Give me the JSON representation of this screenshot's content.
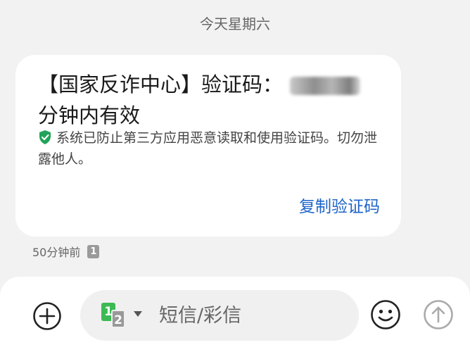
{
  "header": {
    "date_label": "今天星期六"
  },
  "message": {
    "text_before_code": "【国家反诈中心】验证码：",
    "text_after_code": "分钟内有效",
    "security_notice": "系统已防止第三方应用恶意读取和使用验证码。切勿泄露他人。",
    "copy_button_label": "复制验证码",
    "timestamp": "50分钟前",
    "sim_badge": "1"
  },
  "composer": {
    "placeholder": "短信/彩信",
    "sim_primary": "1",
    "sim_secondary": "2"
  },
  "icons": {
    "shield": "shield-check-icon",
    "add": "plus-circle-icon",
    "emoji": "smiley-icon",
    "send": "arrow-up-circle-icon"
  },
  "colors": {
    "accent": "#1e64c8",
    "shield_green": "#22a35a",
    "sim1_green": "#3cba54"
  }
}
